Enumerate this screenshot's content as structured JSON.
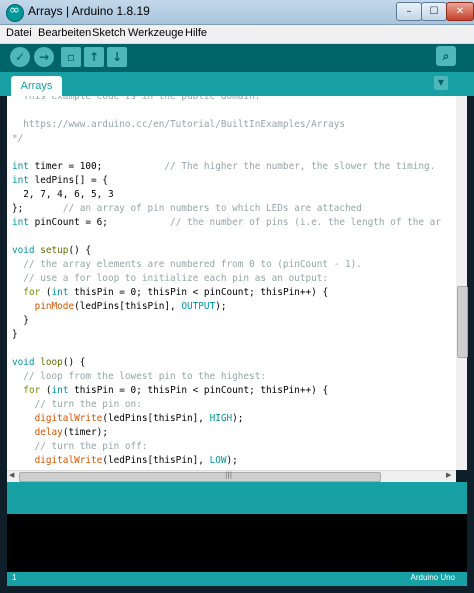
{
  "window": {
    "title": "Arrays | Arduino 1.8.19",
    "minimize": "–",
    "maximize": "☐",
    "close": "✕"
  },
  "menubar": {
    "items": [
      "Datei",
      "Bearbeiten",
      "Sketch",
      "Werkzeuge",
      "Hilfe"
    ]
  },
  "toolbar": {
    "verify": "✓",
    "upload": "→",
    "new": "▫",
    "open": "↑",
    "save": "↓",
    "serial": "⌕"
  },
  "tabs": [
    {
      "label": "Arrays"
    }
  ],
  "tab_menu": "▼",
  "editor": {
    "lines": [
      [
        [
          "comment",
          "  This example code is in the public domain."
        ]
      ],
      [
        [
          "comment",
          ""
        ]
      ],
      [
        [
          "comment",
          "  https://www.arduino.cc/en/Tutorial/BuiltInExamples/Arrays"
        ]
      ],
      [
        [
          "comment",
          "*/"
        ]
      ],
      [
        [
          "plain",
          ""
        ]
      ],
      [
        [
          "type",
          "int"
        ],
        [
          "plain",
          " timer = 100;           "
        ],
        [
          "comment",
          "// The higher the number, the slower the timing."
        ]
      ],
      [
        [
          "type",
          "int"
        ],
        [
          "plain",
          " ledPins[] = {"
        ]
      ],
      [
        [
          "plain",
          "  2, 7, 4, 6, 5, 3"
        ]
      ],
      [
        [
          "plain",
          "};       "
        ],
        [
          "comment",
          "// an array of pin numbers to which LEDs are attached"
        ]
      ],
      [
        [
          "type",
          "int"
        ],
        [
          "plain",
          " pinCount = 6;           "
        ],
        [
          "comment",
          "// the number of pins (i.e. the length of the ar"
        ]
      ],
      [
        [
          "plain",
          ""
        ]
      ],
      [
        [
          "type",
          "void"
        ],
        [
          "plain",
          " "
        ],
        [
          "func",
          "setup"
        ],
        [
          "plain",
          "() {"
        ]
      ],
      [
        [
          "comment",
          "  // the array elements are numbered from 0 to (pinCount - 1)."
        ]
      ],
      [
        [
          "comment",
          "  // use a for loop to initialize each pin as an output:"
        ]
      ],
      [
        [
          "plain",
          "  "
        ],
        [
          "keyword",
          "for"
        ],
        [
          "plain",
          " ("
        ],
        [
          "type",
          "int"
        ],
        [
          "plain",
          " thisPin = 0; thisPin < pinCount; thisPin++) {"
        ]
      ],
      [
        [
          "plain",
          "    "
        ],
        [
          "builtin",
          "pinMode"
        ],
        [
          "plain",
          "(ledPins[thisPin], "
        ],
        [
          "const",
          "OUTPUT"
        ],
        [
          "plain",
          ");"
        ]
      ],
      [
        [
          "plain",
          "  }"
        ]
      ],
      [
        [
          "plain",
          "}"
        ]
      ],
      [
        [
          "plain",
          ""
        ]
      ],
      [
        [
          "type",
          "void"
        ],
        [
          "plain",
          " "
        ],
        [
          "func",
          "loop"
        ],
        [
          "plain",
          "() {"
        ]
      ],
      [
        [
          "comment",
          "  // loop from the lowest pin to the highest:"
        ]
      ],
      [
        [
          "plain",
          "  "
        ],
        [
          "keyword",
          "for"
        ],
        [
          "plain",
          " ("
        ],
        [
          "type",
          "int"
        ],
        [
          "plain",
          " thisPin = 0; thisPin < pinCount; thisPin++) {"
        ]
      ],
      [
        [
          "comment",
          "    // turn the pin on:"
        ]
      ],
      [
        [
          "plain",
          "    "
        ],
        [
          "builtin",
          "digitalWrite"
        ],
        [
          "plain",
          "(ledPins[thisPin], "
        ],
        [
          "const",
          "HIGH"
        ],
        [
          "plain",
          ");"
        ]
      ],
      [
        [
          "plain",
          "    "
        ],
        [
          "builtin",
          "delay"
        ],
        [
          "plain",
          "(timer);"
        ]
      ],
      [
        [
          "comment",
          "    // turn the pin off:"
        ]
      ],
      [
        [
          "plain",
          "    "
        ],
        [
          "builtin",
          "digitalWrite"
        ],
        [
          "plain",
          "(ledPins[thisPin], "
        ],
        [
          "const",
          "LOW"
        ],
        [
          "plain",
          ");"
        ]
      ]
    ]
  },
  "hscroll": {
    "left": "◀",
    "right": "▶",
    "grip": "|||"
  },
  "status": {
    "line": "1",
    "board": "Arduino Uno"
  },
  "colors": {
    "comment": "#95a5a6",
    "type": "#00979d",
    "keyword": "#728e00",
    "builtin": "#d35400",
    "func": "#5e6d03",
    "const": "#00979d",
    "plain": "#000000"
  }
}
